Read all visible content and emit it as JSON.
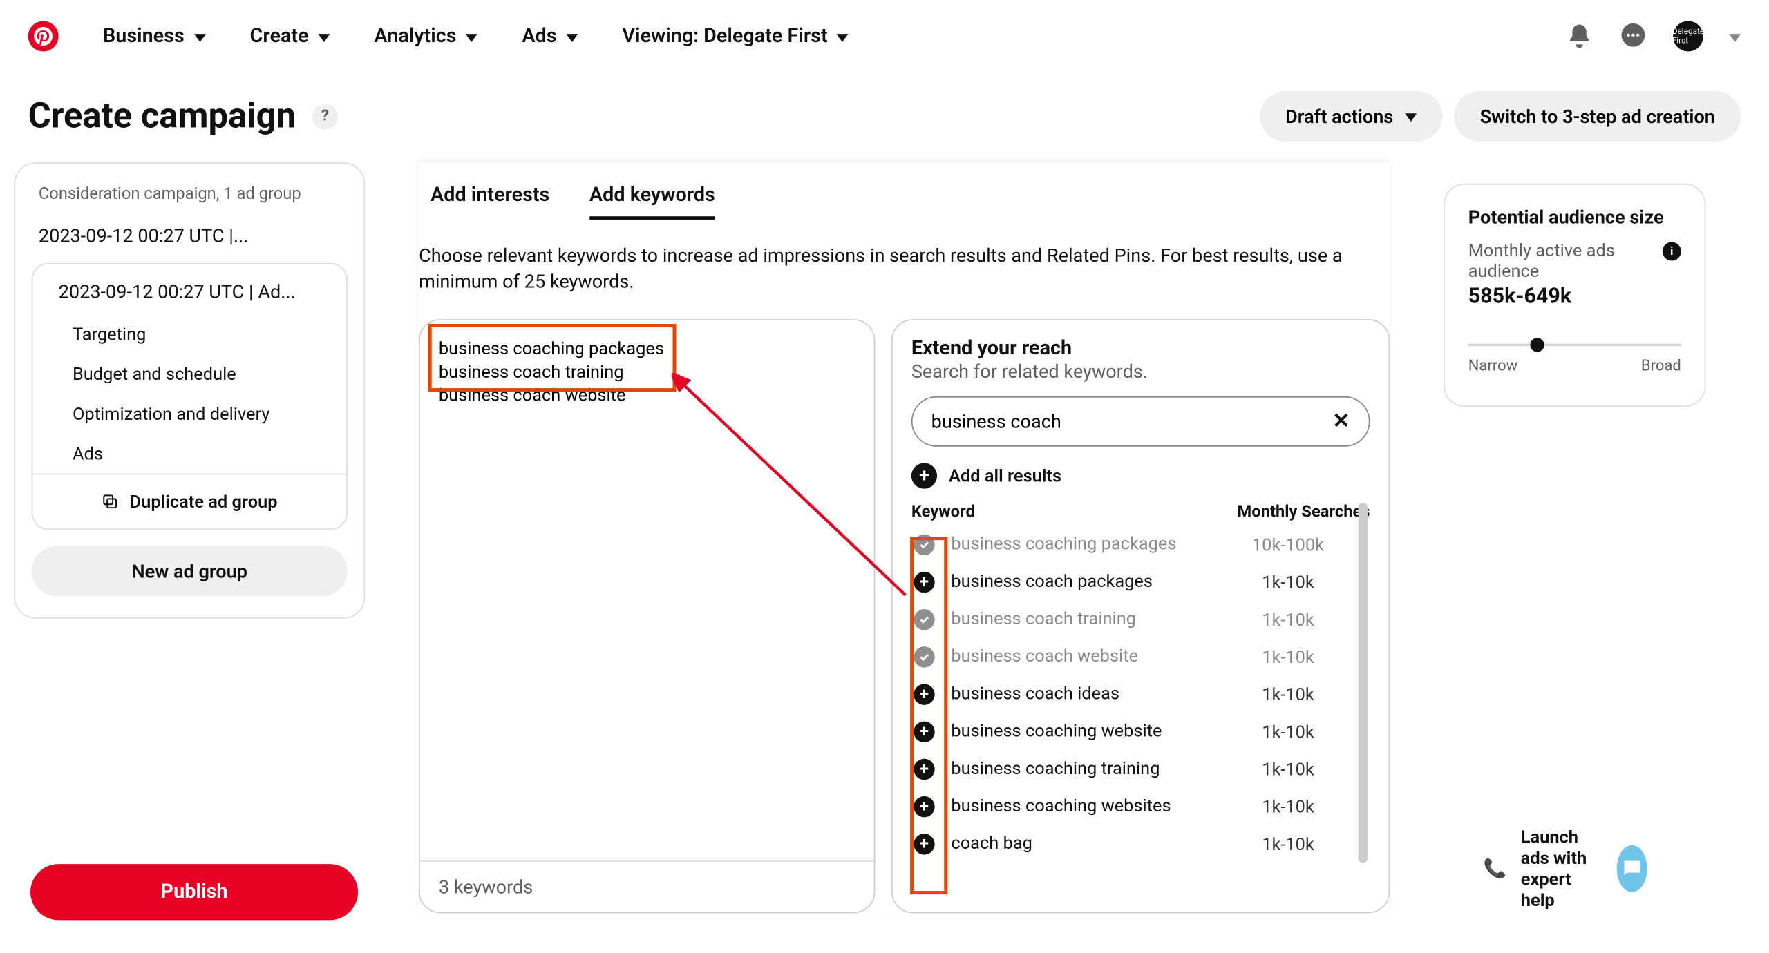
{
  "nav": {
    "items": [
      "Business",
      "Create",
      "Analytics",
      "Ads"
    ],
    "viewing": "Viewing: Delegate First",
    "avatar_text": "Delegate First"
  },
  "page": {
    "title": "Create campaign",
    "draft_actions": "Draft actions",
    "switch_mode": "Switch to 3-step ad creation"
  },
  "sidebar": {
    "meta": "Consideration campaign, 1 ad group",
    "campaign_name": "2023-09-12 00:27 UTC |...",
    "adgroup_name": "2023-09-12 00:27 UTC | Ad...",
    "subs": [
      "Targeting",
      "Budget and schedule",
      "Optimization and delivery",
      "Ads"
    ],
    "duplicate": "Duplicate ad group",
    "new_group": "New ad group",
    "publish": "Publish"
  },
  "tabs": {
    "interests": "Add interests",
    "keywords": "Add keywords"
  },
  "desc": "Choose relevant keywords to increase ad impressions in search results and Related Pins. For best results, use a minimum of 25 keywords.",
  "keywords_entered": "business coaching packages\nbusiness coach training\nbusiness coach website",
  "keywords_footer": "3 keywords",
  "reach": {
    "title": "Extend your reach",
    "sub": "Search for related keywords.",
    "query": "business coach",
    "add_all": "Add all results",
    "head_keyword": "Keyword",
    "head_vol": "Monthly Searches",
    "rows": [
      {
        "name": "business coaching packages",
        "vol": "10k-100k",
        "added": true
      },
      {
        "name": "business coach packages",
        "vol": "1k-10k",
        "added": false
      },
      {
        "name": "business coach training",
        "vol": "1k-10k",
        "added": true
      },
      {
        "name": "business coach website",
        "vol": "1k-10k",
        "added": true
      },
      {
        "name": "business coach ideas",
        "vol": "1k-10k",
        "added": false
      },
      {
        "name": "business coaching website",
        "vol": "1k-10k",
        "added": false
      },
      {
        "name": "business coaching training",
        "vol": "1k-10k",
        "added": false
      },
      {
        "name": "business coaching websites",
        "vol": "1k-10k",
        "added": false
      },
      {
        "name": "coach bag",
        "vol": "1k-10k",
        "added": false
      }
    ]
  },
  "audience": {
    "title": "Potential audience size",
    "label": "Monthly active ads audience",
    "value": "585k-649k",
    "narrow": "Narrow",
    "broad": "Broad",
    "pos_pct": 29
  },
  "launch": {
    "line1": "Launch ads with",
    "line2": "expert help"
  }
}
